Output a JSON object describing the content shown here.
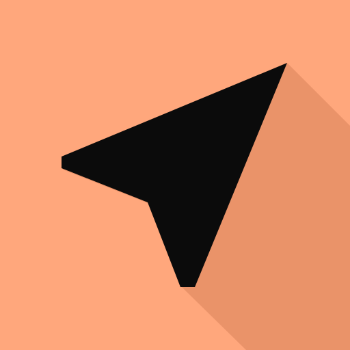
{
  "icon": {
    "name": "navigation-arrow-icon",
    "background_color": "#ffa77c",
    "glyph_color": "#0b0b0b",
    "shadow_color": "#e68f66"
  }
}
